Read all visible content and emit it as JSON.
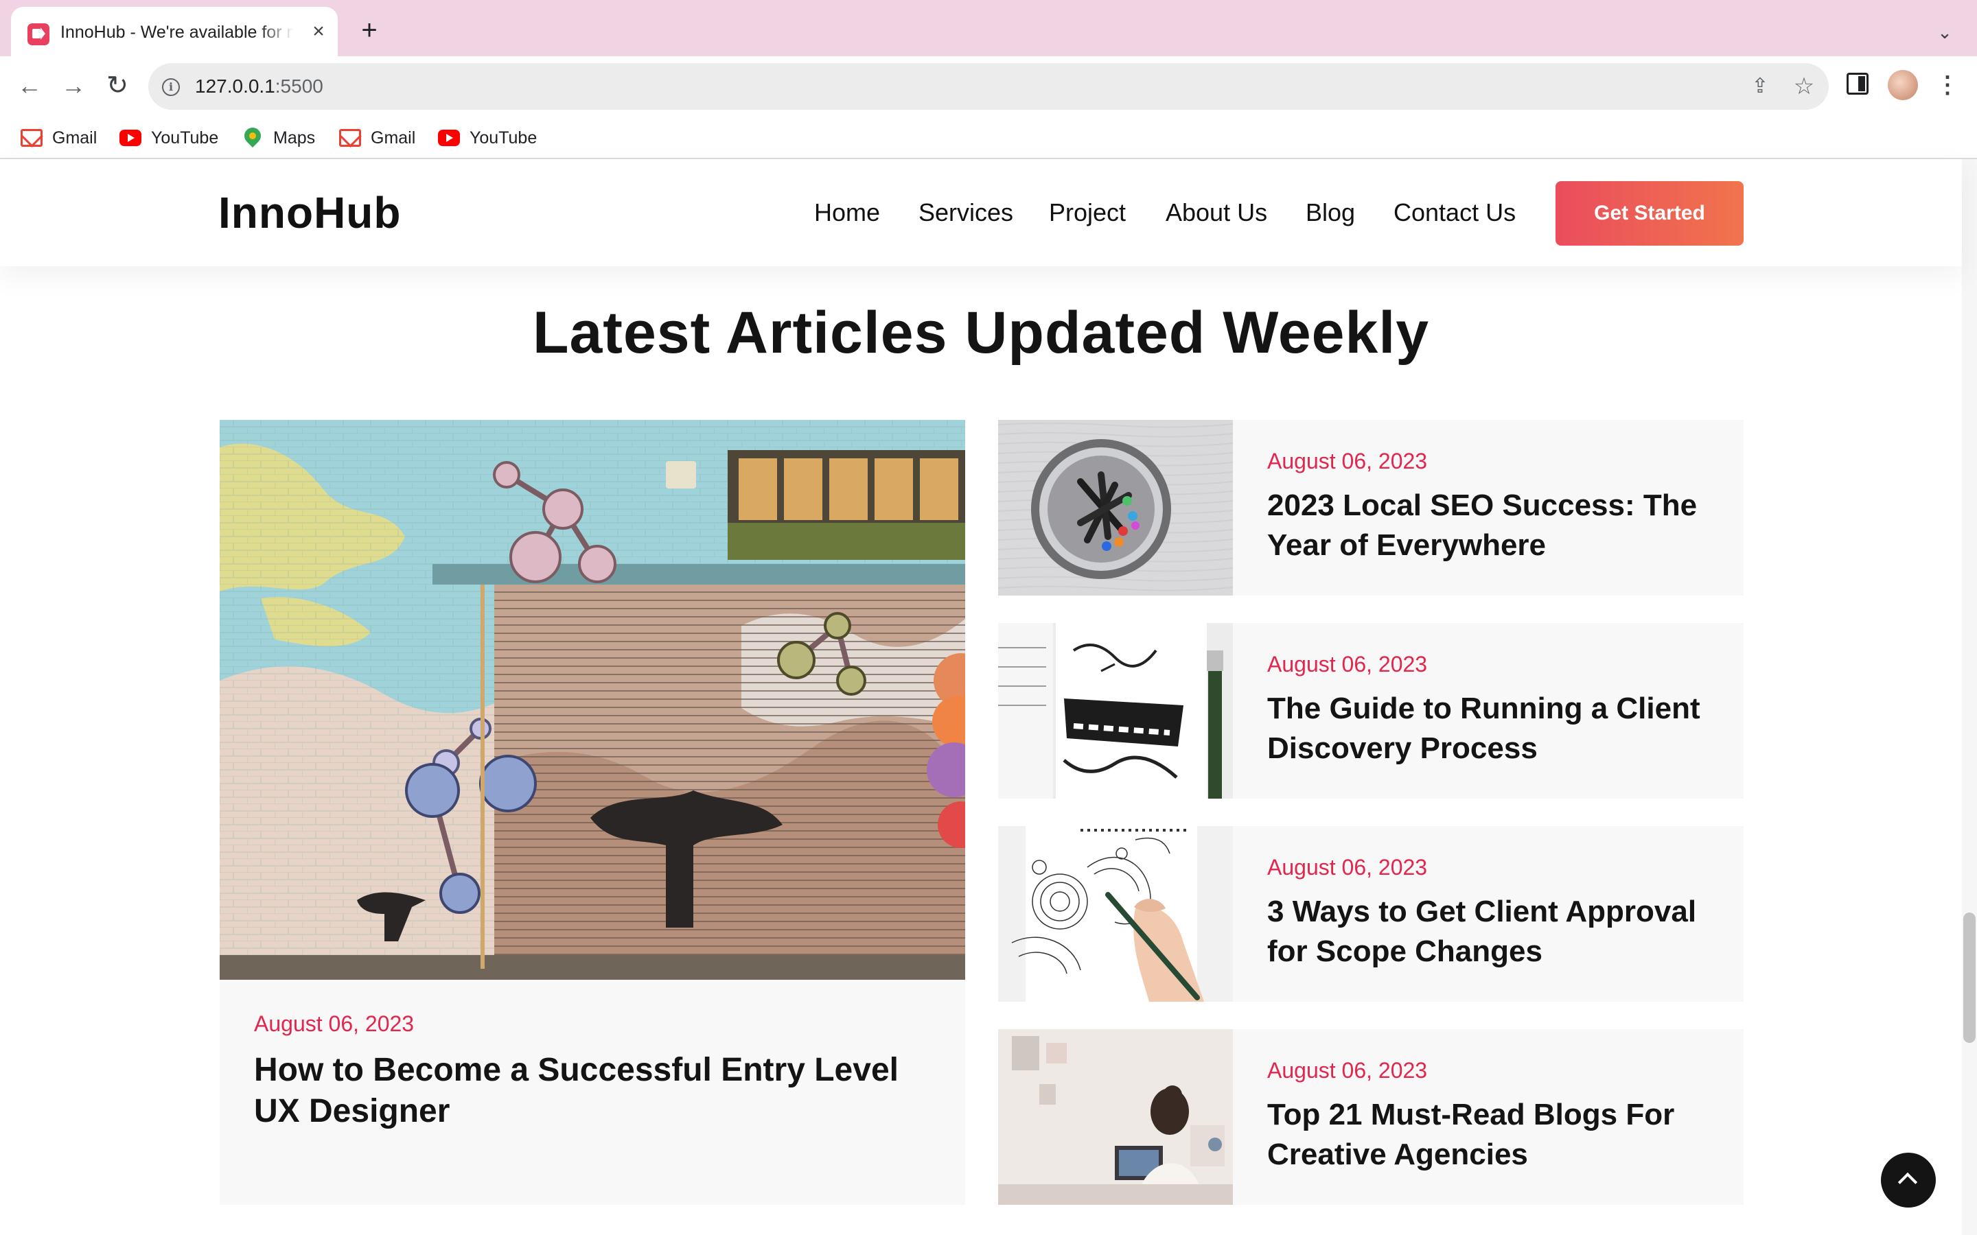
{
  "browser": {
    "tab": {
      "title": "InnoHub - We're available for n"
    },
    "url": {
      "host": "127.0.0.1",
      "port": ":5500"
    },
    "bookmarks": [
      {
        "label": "Gmail",
        "icon": "gmail-icon"
      },
      {
        "label": "YouTube",
        "icon": "youtube-icon"
      },
      {
        "label": "Maps",
        "icon": "maps-icon"
      },
      {
        "label": "Gmail",
        "icon": "gmail-icon"
      },
      {
        "label": "YouTube",
        "icon": "youtube-icon"
      }
    ]
  },
  "site": {
    "logo": "InnoHub",
    "nav": [
      "Home",
      "Services",
      "Project",
      "About Us",
      "Blog",
      "Contact Us"
    ],
    "cta": "Get Started",
    "accent_color": "#e2264d",
    "cta_gradient": [
      "#ea4d5c",
      "#f1744d"
    ]
  },
  "section": {
    "title": "Latest Articles Updated Weekly"
  },
  "featured": {
    "date": "August 06, 2023",
    "title": "How to Become a Successful Entry Level UX Designer",
    "image": "graffiti-mural-image"
  },
  "articles": [
    {
      "date": "August 06, 2023",
      "title": "2023 Local SEO Success: The Year of Everywhere",
      "image": "pens-cup-image"
    },
    {
      "date": "August 06, 2023",
      "title": "The Guide to Running a Client Discovery Process",
      "image": "fresh-start-notebook-image"
    },
    {
      "date": "August 06, 2023",
      "title": "3 Ways to Get Client Approval for Scope Changes",
      "image": "doodle-drawing-image"
    },
    {
      "date": "August 06, 2023",
      "title": "Top 21 Must-Read Blogs For Creative Agencies",
      "image": "woman-at-desk-image"
    }
  ]
}
